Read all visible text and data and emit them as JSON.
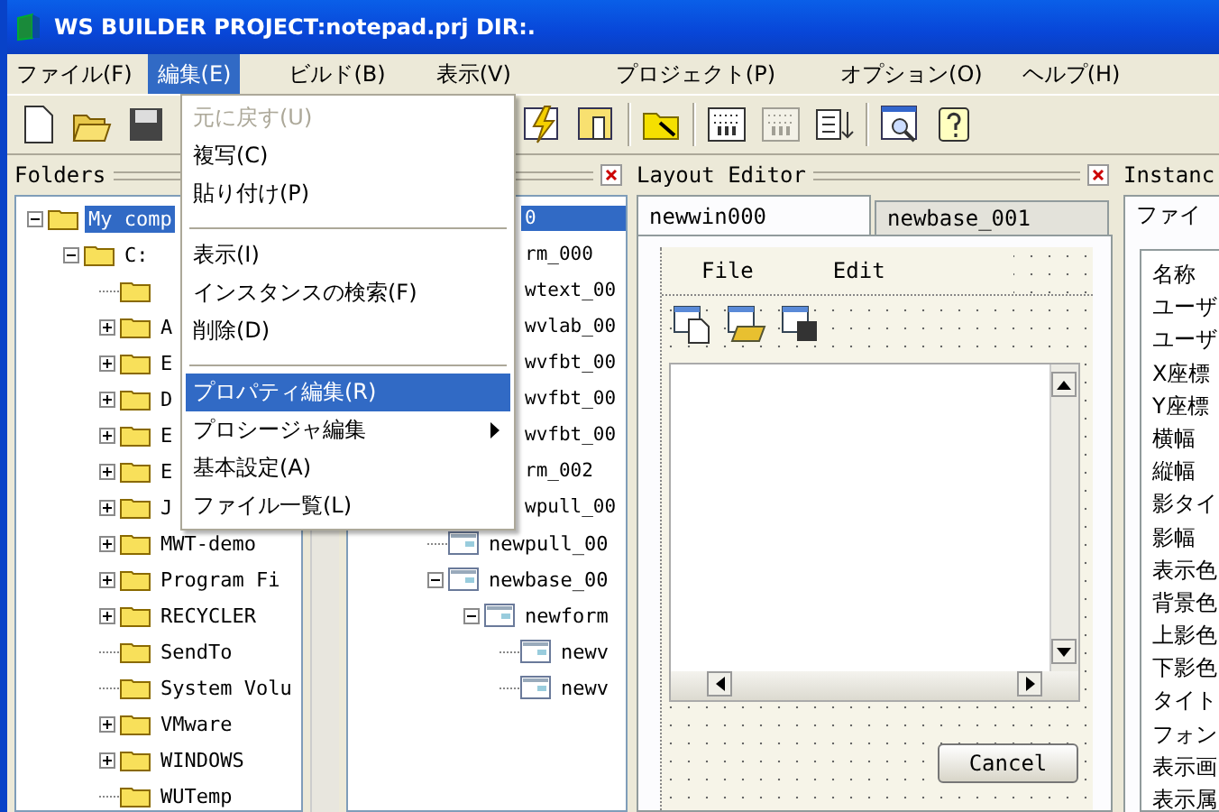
{
  "window": {
    "title": "WS BUILDER PROJECT:notepad.prj DIR:."
  },
  "menubar": [
    {
      "label": "ファイル(F)",
      "selected": false
    },
    {
      "label": "編集(E)",
      "selected": true
    },
    {
      "label": "ビルド(B)",
      "selected": false
    },
    {
      "label": "表示(V)",
      "selected": false
    },
    {
      "label": "プロジェクト(P)",
      "selected": false
    },
    {
      "label": "オプション(O)",
      "selected": false
    },
    {
      "label": "ヘルプ(H)",
      "selected": false
    }
  ],
  "toolbar": [
    {
      "kind": "new"
    },
    {
      "kind": "open"
    },
    {
      "kind": "save"
    },
    {
      "kind": "gap"
    },
    {
      "kind": "build",
      "disabled": false
    },
    {
      "kind": "tool",
      "disabled": false
    },
    {
      "kind": "sep"
    },
    {
      "kind": "folder",
      "disabled": false
    },
    {
      "kind": "sep"
    },
    {
      "kind": "grid",
      "disabled": false
    },
    {
      "kind": "grid",
      "disabled": true
    },
    {
      "kind": "list",
      "disabled": false
    },
    {
      "kind": "sep"
    },
    {
      "kind": "preview",
      "disabled": false
    },
    {
      "kind": "help",
      "disabled": false
    }
  ],
  "edit_menu": [
    {
      "kind": "item",
      "label": "元に戻す(U)",
      "disabled": true,
      "selected": false
    },
    {
      "kind": "item",
      "label": "複写(C)",
      "disabled": false,
      "selected": false
    },
    {
      "kind": "item",
      "label": "貼り付け(P)",
      "disabled": false,
      "selected": false
    },
    {
      "kind": "sep"
    },
    {
      "kind": "item",
      "label": "表示(I)",
      "disabled": false,
      "selected": false
    },
    {
      "kind": "item",
      "label": "インスタンスの検索(F)",
      "disabled": false,
      "selected": false
    },
    {
      "kind": "item",
      "label": "削除(D)",
      "disabled": false,
      "selected": false
    },
    {
      "kind": "sep"
    },
    {
      "kind": "item",
      "label": "プロパティ編集(R)",
      "disabled": false,
      "selected": true
    },
    {
      "kind": "submenu",
      "label": "プロシージャ編集",
      "disabled": false,
      "selected": false
    },
    {
      "kind": "item",
      "label": "基本設定(A)",
      "disabled": false,
      "selected": false
    },
    {
      "kind": "item",
      "label": "ファイル一覧(L)",
      "disabled": false,
      "selected": false
    }
  ],
  "folders_panel": {
    "title": "Folders",
    "tree": [
      {
        "label": "My comp",
        "selected": true,
        "expanded": true,
        "children": [
          {
            "label": "C:",
            "selected": false,
            "expanded": true,
            "children": [
              {
                "kind": "leaf"
              },
              {
                "label": "A",
                "expanded": false
              },
              {
                "label": "E",
                "expanded": false
              },
              {
                "label": "D",
                "expanded": false
              },
              {
                "label": "E",
                "expanded": false
              },
              {
                "label": "E",
                "expanded": false
              },
              {
                "label": "J",
                "expanded": false
              },
              {
                "label": "MWT-demo",
                "expanded": false
              },
              {
                "label": "Program Fi",
                "expanded": false
              },
              {
                "label": "RECYCLER",
                "expanded": false
              },
              {
                "label": "SendTo"
              },
              {
                "label": "System Volu"
              },
              {
                "label": "VMware",
                "expanded": false
              },
              {
                "label": "WINDOWS",
                "expanded": false
              },
              {
                "label": "WUTemp"
              }
            ]
          }
        ]
      }
    ],
    "instances_covered": [
      {
        "label": "0",
        "selected": true
      },
      {
        "label": "rm_000",
        "selected": false
      },
      {
        "label": "wtext_00",
        "selected": false
      },
      {
        "label": "wvlab_00",
        "selected": false
      },
      {
        "label": "wvfbt_00",
        "selected": false
      },
      {
        "label": "wvfbt_00",
        "selected": false
      },
      {
        "label": "wvfbt_00",
        "selected": false
      },
      {
        "label": "rm_002",
        "selected": false
      },
      {
        "label": "wpull_00",
        "selected": false
      }
    ],
    "instances": [
      {
        "label": "newpull_00"
      },
      {
        "label": "newbase_00",
        "expanded": true,
        "children": [
          {
            "label": "newform",
            "expanded": true,
            "children": [
              {
                "label": "newv"
              },
              {
                "label": "newv"
              }
            ]
          }
        ]
      }
    ]
  },
  "layout_editor": {
    "title": "Layout Editor",
    "tabs": [
      {
        "label": "newwin000",
        "selected": true
      },
      {
        "label": "newbase_001",
        "selected": false
      }
    ],
    "form": {
      "menu": [
        "File",
        "Edit"
      ],
      "button": "Cancel"
    }
  },
  "instance_panel": {
    "title": "Instanc",
    "tab": "ファイ",
    "properties": [
      "名称",
      "ユーザ",
      "ユーザ",
      "X座標",
      "Y座標",
      "横幅",
      "縦幅",
      "影タイ",
      "影幅",
      "表示色",
      "背景色",
      "上影色",
      "下影色",
      "タイト",
      "フォン",
      "表示画",
      "表示属"
    ]
  }
}
